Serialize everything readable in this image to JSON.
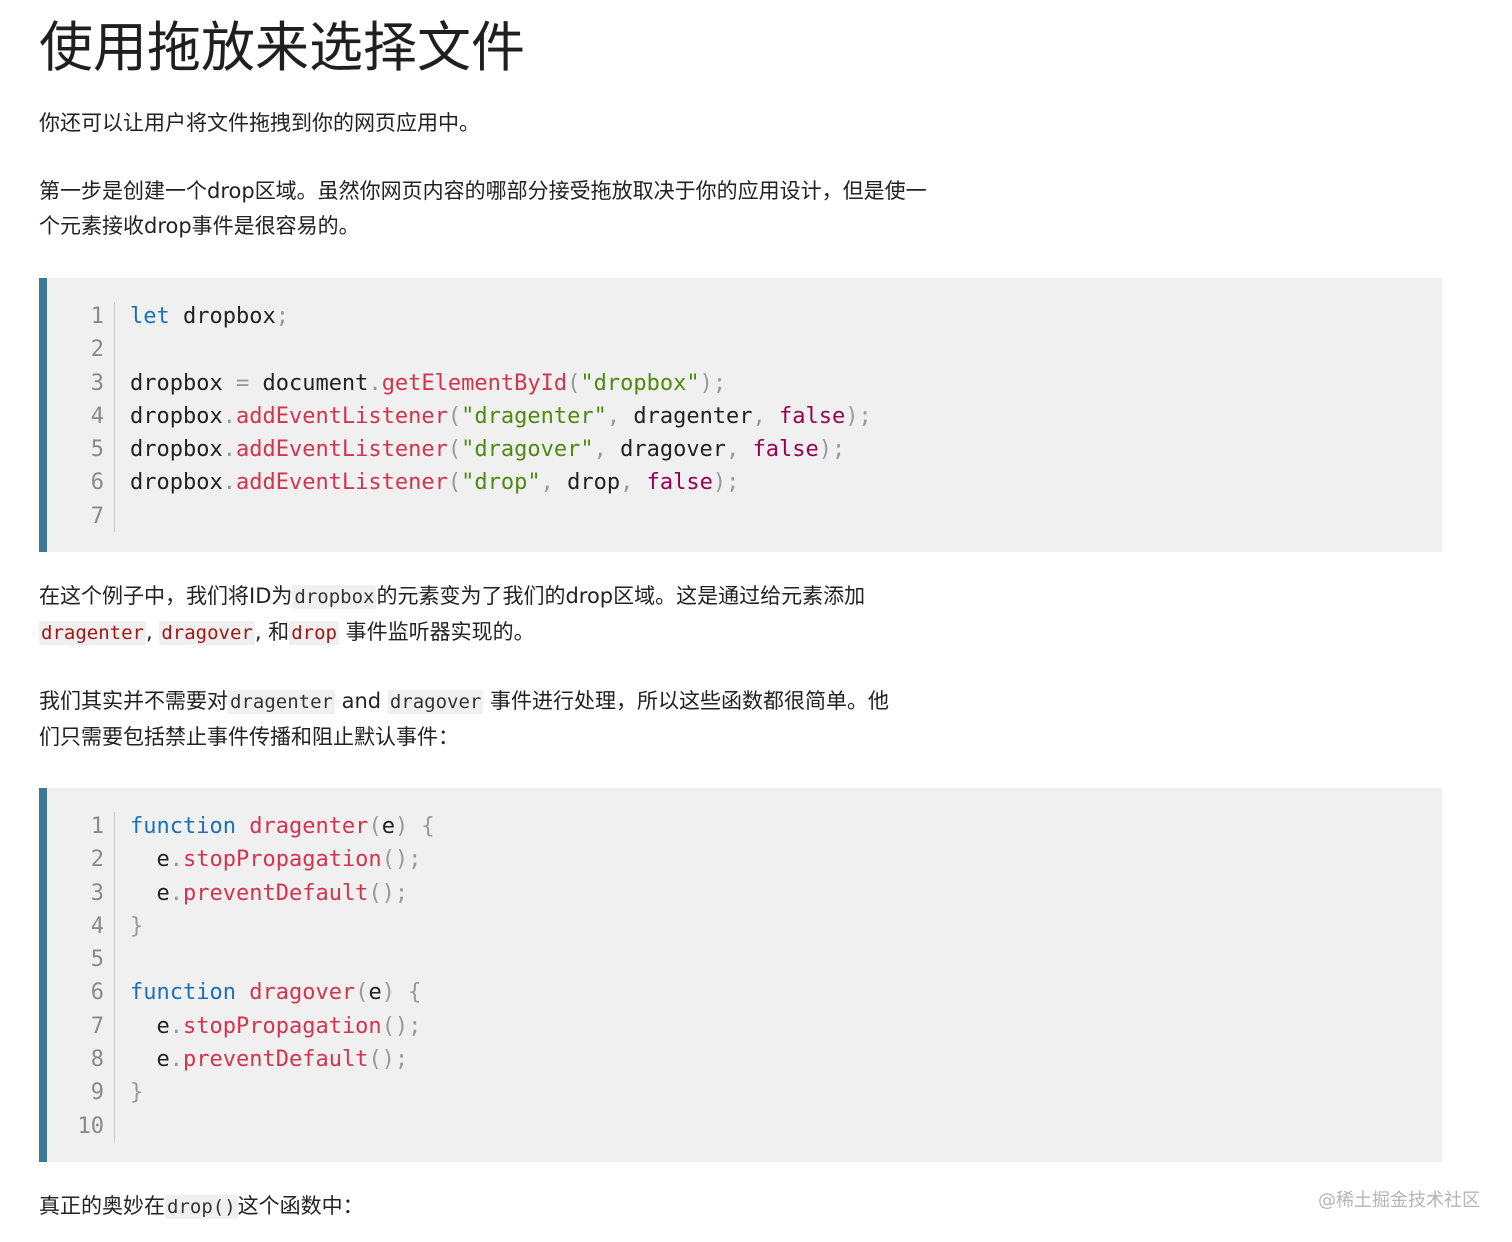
{
  "heading": "使用拖放来选择文件",
  "p1": "你还可以让用户将文件拖拽到你的网页应用中。",
  "p2": {
    "line1": "第一步是创建一个drop区域。虽然你网页内容的哪部分接受拖放取决于你的应用设计，但是使一",
    "line2": "个元素接收drop事件是很容易的。"
  },
  "code1": {
    "line_numbers": [
      "1",
      "2",
      "3",
      "4",
      "5",
      "6",
      "7"
    ]
  },
  "p3": {
    "a": "在这个例子中，我们将ID为",
    "code_dropbox": "dropbox",
    "b": "的元素变为了我们的drop区域。这是通过给元素添加",
    "code_dragenter": "dragenter",
    "sep1": ", ",
    "code_dragover": "dragover",
    "c": ", 和",
    "code_drop": "drop",
    "d": " 事件监听器实现的。"
  },
  "p4": {
    "a": "我们其实并不需要对",
    "code_dragenter": "dragenter",
    "b": " and ",
    "code_dragover": "dragover",
    "c": " 事件进行处理，所以这些函数都很简单。他",
    "line2": "们只需要包括禁止事件传播和阻止默认事件："
  },
  "code2": {
    "line_numbers": [
      "1",
      "2",
      "3",
      "4",
      "5",
      "6",
      "7",
      "8",
      "9",
      "10"
    ]
  },
  "p5": {
    "a": "真正的奥妙在",
    "code_drop": "drop()",
    "b": "这个函数中："
  },
  "watermark": "@稀土掘金技术社区",
  "colors": {
    "accent_bar": "#3e7a96",
    "keyword": "#1d6fb8",
    "function": "#d2344f",
    "string": "#4d8a10",
    "boolean": "#990055"
  }
}
